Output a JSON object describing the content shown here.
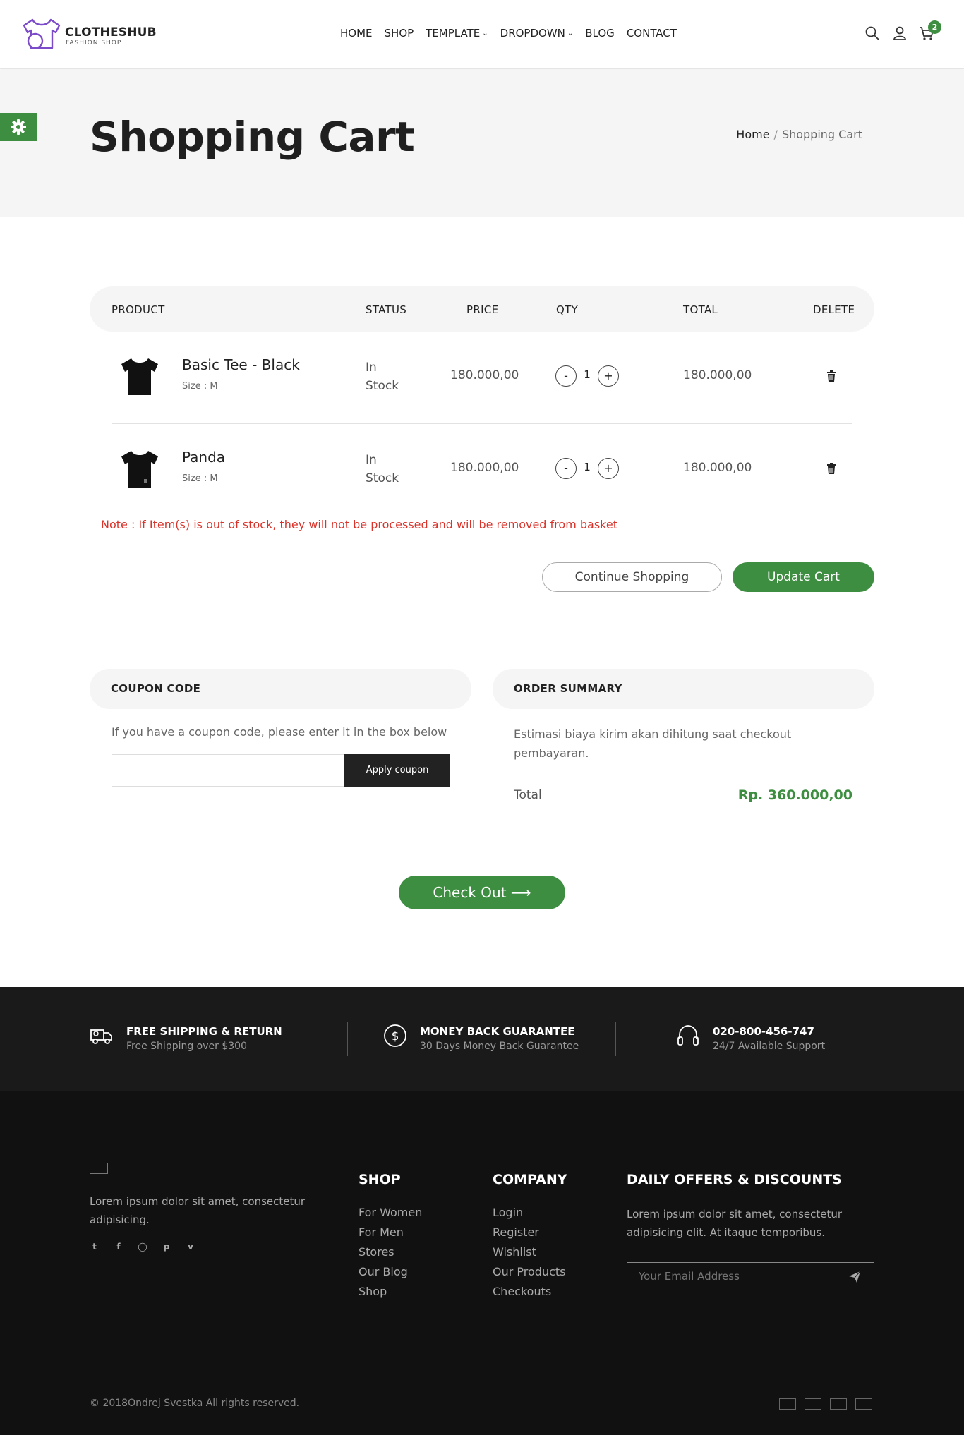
{
  "header": {
    "logo_title": "CLOTHESHUB",
    "logo_subtitle": "FASHION SHOP",
    "nav": [
      {
        "label": "HOME"
      },
      {
        "label": "SHOP"
      },
      {
        "label": "TEMPLATE",
        "dropdown": true
      },
      {
        "label": "DROPDOWN",
        "dropdown": true
      },
      {
        "label": "BLOG"
      },
      {
        "label": "CONTACT"
      }
    ],
    "icons": [
      "search-icon",
      "user-icon",
      "cart-icon"
    ],
    "cart_count": "2"
  },
  "page_title": "Shopping Cart",
  "breadcrumb": {
    "home": "Home",
    "separator": "/",
    "current": "Shopping Cart"
  },
  "settings_icon": "gear-icon",
  "cart_table": {
    "headers": {
      "product": "PRODUCT",
      "status": "STATUS",
      "price": "PRICE",
      "qty": "QTY",
      "total": "TOTAL",
      "delete": "DELETE"
    },
    "rows": [
      {
        "name": "Basic Tee - Black",
        "size": "Size : M",
        "status": "In Stock",
        "price": "180.000,00",
        "qty": "1",
        "total": "180.000,00",
        "minus": "-",
        "plus": "+"
      },
      {
        "name": "Panda",
        "size": "Size : M",
        "status": "In Stock",
        "price": "180.000,00",
        "qty": "1",
        "total": "180.000,00",
        "minus": "-",
        "plus": "+"
      }
    ]
  },
  "note": "Note : If Item(s) is out of stock, they will not be processed and will be removed from basket",
  "buttons": {
    "continue": "Continue Shopping",
    "update": "Update Cart",
    "checkout": "Check Out ⟶"
  },
  "coupon": {
    "heading": "COUPON CODE",
    "text": "If you have a coupon code, please enter it in the box below",
    "input_value": "",
    "apply": "Apply coupon"
  },
  "order_summary": {
    "heading": "ORDER SUMMARY",
    "text": "Estimasi biaya kirim akan dihitung saat checkout pembayaran.",
    "total_label": "Total",
    "total_value": "Rp. 360.000,00"
  },
  "features": [
    {
      "icon": "truck-icon",
      "title": "FREE SHIPPING & RETURN",
      "subtitle": "Free Shipping over $300"
    },
    {
      "icon": "dollar-icon",
      "title": "MONEY BACK GUARANTEE",
      "subtitle": "30 Days Money Back Guarantee"
    },
    {
      "icon": "headset-icon",
      "title": "020-800-456-747",
      "subtitle": "24/7 Available Support"
    }
  ],
  "footer": {
    "about": "Lorem ipsum dolor sit amet, consectetur adipisicing.",
    "socials": [
      "twitter-icon",
      "facebook-icon",
      "instagram-icon",
      "pinterest-icon",
      "vimeo-icon"
    ],
    "shop": {
      "title": "SHOP",
      "links": [
        "For Women",
        "For Men",
        "Stores",
        "Our Blog",
        "Shop"
      ]
    },
    "company": {
      "title": "COMPANY",
      "links": [
        "Login",
        "Register",
        "Wishlist",
        "Our Products",
        "Checkouts"
      ]
    },
    "offers": {
      "title": "DAILY OFFERS & DISCOUNTS",
      "text": "Lorem ipsum dolor sit amet, consectetur adipisicing elit. At itaque temporibus.",
      "email_placeholder": "Your Email Address"
    },
    "copyright": "© 2018Ondrej Svestka All rights reserved.",
    "payment_icons": [
      "payment-icon-1",
      "payment-icon-2",
      "payment-icon-3",
      "payment-icon-4"
    ]
  },
  "colors": {
    "accent": "#3e8e41",
    "note": "#d9342b",
    "dark": "#1a1a1a",
    "footer": "#111111"
  }
}
